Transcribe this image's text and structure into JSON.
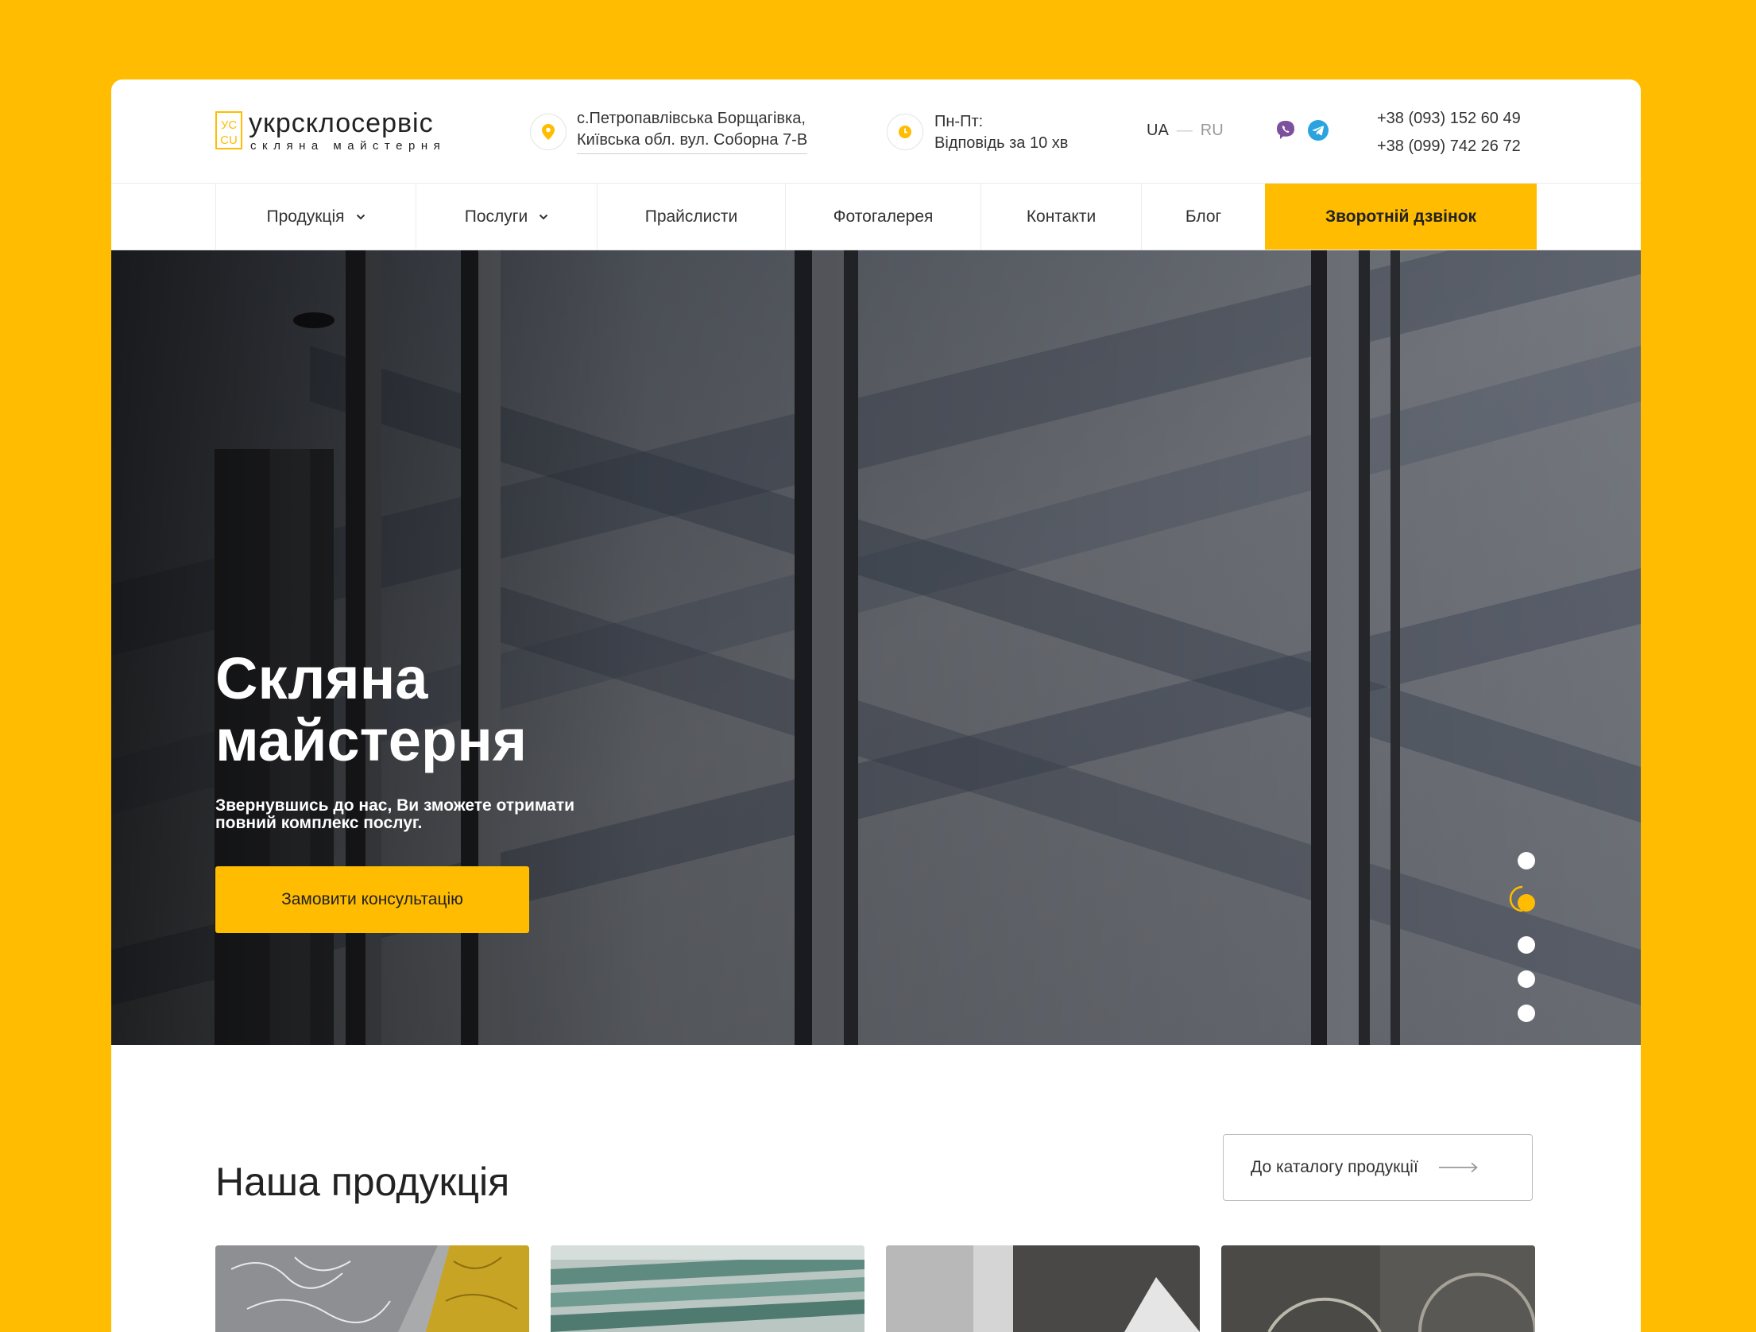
{
  "logo": {
    "mark": "УС",
    "name": "укрсклосервіс",
    "tagline": "склянa майстерня"
  },
  "header": {
    "address_line1": "с.Петропавлівська Борщагівка,",
    "address_line2": "Київська обл. вул. Соборна 7-В",
    "hours_line1": "Пн-Пт:",
    "hours_line2": "Відповідь за 10 хв",
    "lang_active": "UA",
    "lang_sep": "—",
    "lang_other": "RU",
    "phone1": "+38 (093) 152 60 49",
    "phone2": "+38 (099) 742 26 72"
  },
  "nav": {
    "items": [
      {
        "label": "Продукція",
        "dropdown": true
      },
      {
        "label": "Послуги",
        "dropdown": true
      },
      {
        "label": "Прайслисти"
      },
      {
        "label": "Фотогалерея"
      },
      {
        "label": "Контакти"
      },
      {
        "label": "Блог"
      }
    ],
    "cta": "Зворотній дзвінок"
  },
  "hero": {
    "title": "Скляна\nмайстерня",
    "subtitle": "Звернувшись до нас, Ви зможете отримати повний комплекс послуг.",
    "button": "Замовити консультацію",
    "slides_total": 5,
    "slide_active": 2
  },
  "products": {
    "title": "Наша продукція",
    "catalog_button": "До каталогу продукції"
  },
  "colors": {
    "accent": "#FFBC00",
    "viber": "#7B519D",
    "telegram": "#2AA3DF"
  },
  "icons": [
    "location-pin-icon",
    "clock-icon",
    "viber-icon",
    "telegram-icon",
    "chevron-down-icon",
    "arrow-right-icon"
  ]
}
